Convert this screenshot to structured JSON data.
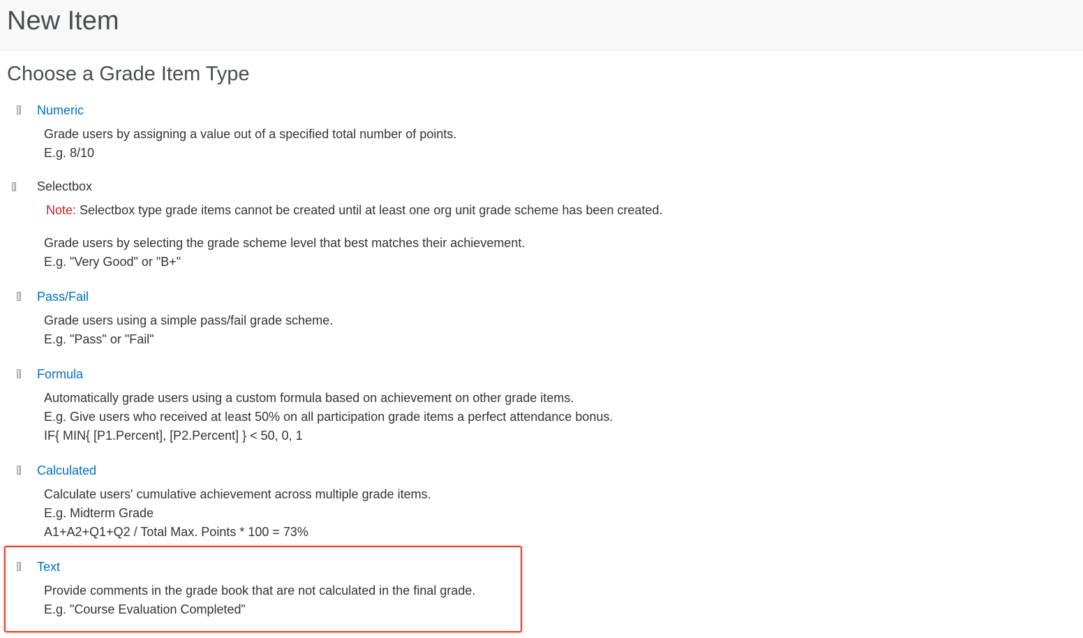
{
  "page": {
    "title": "New Item",
    "section_title": "Choose a Grade Item Type"
  },
  "items": [
    {
      "label": "Numeric",
      "link": true,
      "lines": [
        "Grade users by assigning a value out of a specified total number of points.",
        "E.g. 8/10"
      ]
    },
    {
      "label": "Selectbox",
      "link": false,
      "note_label": "Note:",
      "note_text": " Selectbox type grade items cannot be created until at least one org unit grade scheme has been created.",
      "lines": [
        "Grade users by selecting the grade scheme level that best matches their achievement.",
        "E.g. \"Very Good\" or \"B+\""
      ]
    },
    {
      "label": "Pass/Fail",
      "link": true,
      "lines": [
        "Grade users using a simple pass/fail grade scheme.",
        "E.g. \"Pass\" or \"Fail\""
      ]
    },
    {
      "label": "Formula",
      "link": true,
      "lines": [
        "Automatically grade users using a custom formula based on achievement on other grade items.",
        "E.g. Give users who received at least 50% on all participation grade items a perfect attendance bonus.",
        "IF{ MIN{ [P1.Percent], [P2.Percent] } < 50, 0, 1"
      ]
    },
    {
      "label": "Calculated",
      "link": true,
      "lines": [
        "Calculate users' cumulative achievement across multiple grade items.",
        "E.g. Midterm Grade",
        "A1+A2+Q1+Q2 / Total Max. Points * 100 = 73%"
      ]
    },
    {
      "label": "Text",
      "link": true,
      "lines": [
        "Provide comments in the grade book that are not calculated in the final grade.",
        "E.g. \"Course Evaluation Completed\""
      ]
    }
  ],
  "colors": {
    "link": "#006fbf",
    "note": "#cd2026",
    "highlight": "#e2412e",
    "text": "#333333",
    "heading": "#494c4e"
  },
  "icons": {
    "item_type": "grade-item-type-icon"
  }
}
